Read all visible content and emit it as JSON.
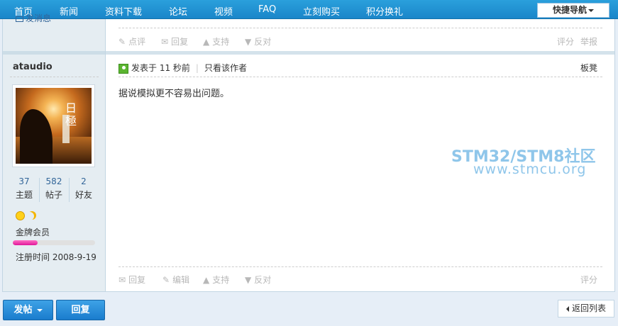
{
  "nav": {
    "items": [
      "首页",
      "新闻",
      "资料下载",
      "论坛",
      "视频",
      "FAQ",
      "立刻购买",
      "积分换礼"
    ],
    "quick_nav": "快捷导航"
  },
  "prev_post": {
    "send_message": "发消息",
    "actions_left": [
      "点评",
      "回复",
      "支持",
      "反对"
    ],
    "actions_right": [
      "评分",
      "举报"
    ]
  },
  "author": {
    "name": "ataudio",
    "stats": [
      {
        "value": "37",
        "label": "主题"
      },
      {
        "value": "582",
        "label": "帖子"
      },
      {
        "value": "2",
        "label": "好友"
      }
    ],
    "rank": "金牌会员",
    "rank_progress": 0.3,
    "register_date": "注册时间 2008-9-19",
    "avatar_glyph": "日極"
  },
  "post": {
    "posted_at": "发表于 11 秒前",
    "author_only": "只看该作者",
    "floor": "板凳",
    "body": "据说模拟更不容易出问题。",
    "actions_left": [
      "回复",
      "编辑",
      "支持",
      "反对"
    ],
    "actions_right": [
      "评分"
    ]
  },
  "watermark": {
    "line1": "STM32/STM8社区",
    "line2": "www.stmcu.org"
  },
  "bottom": {
    "new_post": "发帖",
    "reply": "回复",
    "back": "返回列表"
  },
  "colors": {
    "nav_bg": "#1a86c9",
    "link": "#336699",
    "watermark": "#8fc6ea",
    "progress": "#e0179a"
  }
}
